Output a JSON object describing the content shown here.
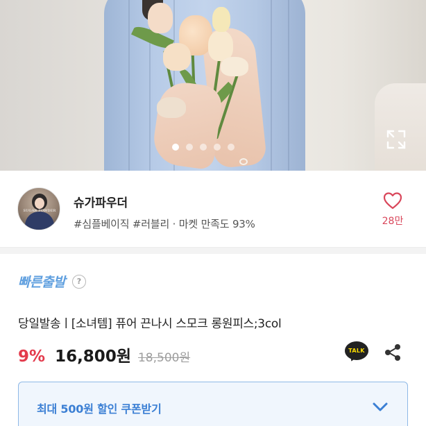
{
  "hero": {
    "slide_count": 5,
    "active_slide": 1,
    "expand_icon": "expand-icon"
  },
  "seller": {
    "avatar_text": "SUGAR POWDER",
    "name": "슈가파우더",
    "tags": "#심플베이직 #러블리 · 마켓 만족도 93%",
    "like_icon": "heart-outline-icon",
    "like_count": "28만"
  },
  "badge": {
    "label": "빠른출발",
    "help_icon": "question-mark-icon",
    "help_glyph": "?"
  },
  "product": {
    "title": "당일발송ㅣ[소녀템] 퓨어 끈나시 스모크 롱원피스;3col",
    "discount": "9%",
    "price": "16,800원",
    "original_price": "18,500원"
  },
  "actions": {
    "talk_label": "TALK",
    "talk_icon": "kakaotalk-icon",
    "share_icon": "share-icon"
  },
  "coupon": {
    "label": "최대 500원 할인 쿠폰받기",
    "chevron_icon": "chevron-down-icon"
  },
  "colors": {
    "accent_blue": "#3b7fd4",
    "badge_blue": "#5f9fdf",
    "discount_red": "#e33a4c",
    "heart_pink": "#d9475b"
  }
}
